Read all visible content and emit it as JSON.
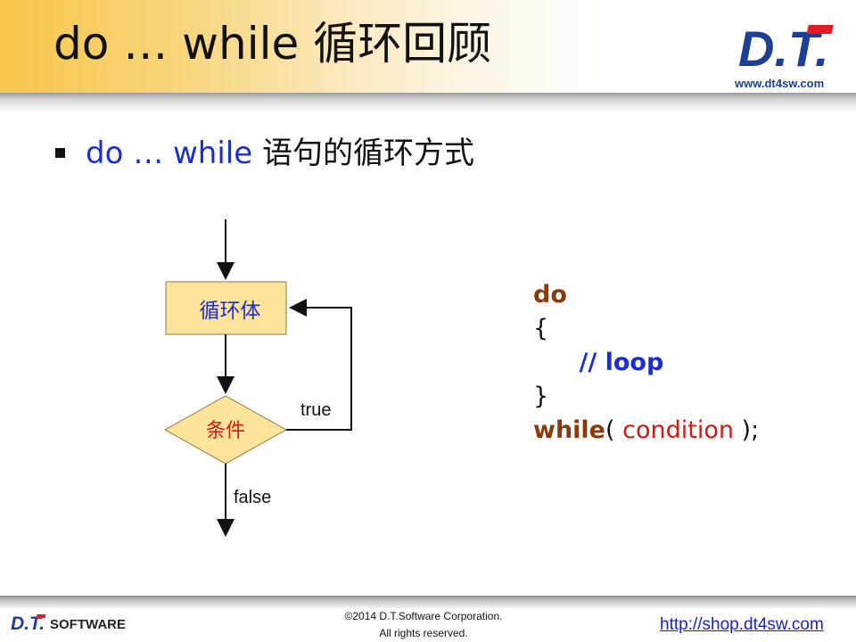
{
  "title": "do … while 循环回顾",
  "brand": {
    "logo_text": "D.T.",
    "url": "www.dt4sw.com"
  },
  "bullet": {
    "keyword": "do … while",
    "rest": " 语句的循环方式"
  },
  "flowchart": {
    "body_label": "循环体",
    "condition_label": "条件",
    "true_label": "true",
    "false_label": "false"
  },
  "code": {
    "line1": "do",
    "line2": "{",
    "line3_comment": "// loop",
    "line4": "}",
    "line5_kw": "while",
    "line5_open": "( ",
    "line5_var": "condition",
    "line5_close": " );"
  },
  "colors": {
    "accent_gold": "#f7c64a",
    "box_fill": "#fde49a",
    "keyword": "#8b3a0a",
    "comment": "#1b2ed6",
    "variable": "#d9150f"
  },
  "footer": {
    "logo_main": "D.T.",
    "logo_sub": "SOFTWARE",
    "copyright": "©2014 D.T.Software Corporation.",
    "rights": "All rights reserved.",
    "link": "http://shop.dt4sw.com"
  }
}
